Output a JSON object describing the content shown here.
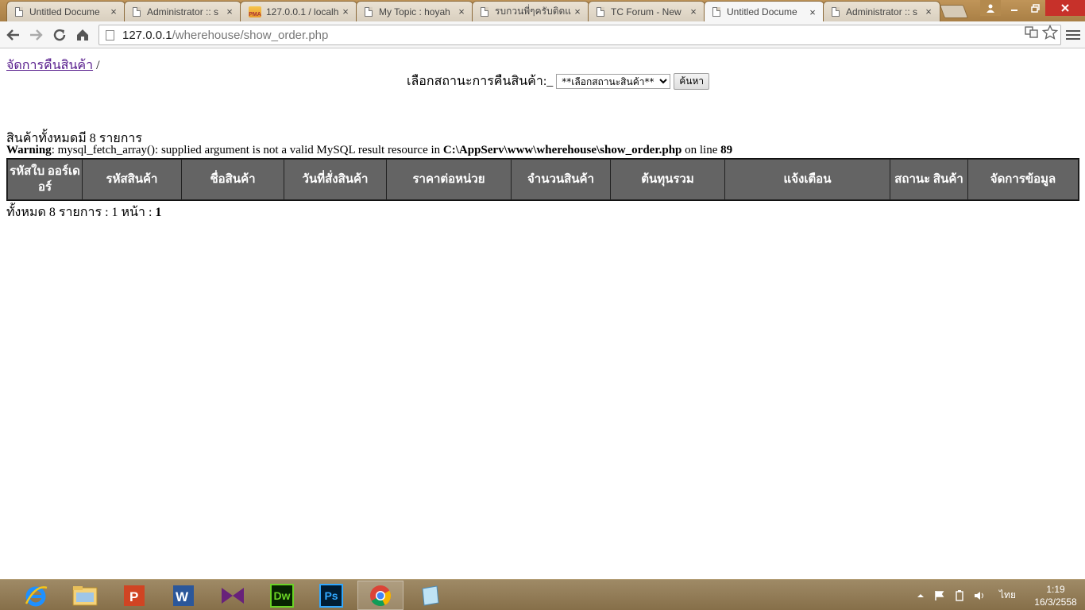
{
  "browser": {
    "tabs": [
      {
        "title": "Untitled Docume",
        "icon": "doc-icon",
        "active": false
      },
      {
        "title": "Administrator :: s",
        "icon": "doc-icon",
        "active": false
      },
      {
        "title": "127.0.0.1 / localh",
        "icon": "phpmyadmin-icon",
        "active": false
      },
      {
        "title": "My Topic : hoyah",
        "icon": "doc-icon",
        "active": false
      },
      {
        "title": "รบกวนพี่ๆครับติดแ",
        "icon": "doc-icon",
        "active": false
      },
      {
        "title": "TC Forum - New",
        "icon": "doc-icon",
        "active": false
      },
      {
        "title": "Untitled Docume",
        "icon": "doc-icon",
        "active": true
      },
      {
        "title": "Administrator :: s",
        "icon": "doc-icon",
        "active": false
      }
    ],
    "tab_close_glyph": "×",
    "pma_badge": "PMA",
    "url": {
      "host": "127.0.0.1",
      "path": "/wherehouse/show_order.php"
    }
  },
  "page": {
    "breadcrumb": {
      "link": "จัดการคืนสินค้า",
      "separator": " /"
    },
    "filter": {
      "label": "เลือกสถานะการคืนสินค้า:_",
      "select_value": "**เลือกสถานะสินค้า**",
      "search_button": "ค้นหา"
    },
    "total_text": "สินค้าทั้งหมดมี 8 รายการ",
    "warning": {
      "label": "Warning",
      "message": ": mysql_fetch_array(): supplied argument is not a valid MySQL result resource in ",
      "file": "C:\\AppServ\\www\\wherehouse\\show_order.php",
      "on_line": " on line ",
      "line": "89"
    },
    "table": {
      "headers": [
        "รหัสใบ ออร์เดอร์",
        "รหัสสินค้า",
        "ชื่อสินค้า",
        "วันที่สั่งสินค้า",
        "ราคาต่อหน่วย",
        "จำนวนสินค้า",
        "ต้นทุนรวม",
        "แจ้งเตือน",
        "สถานะ สินค้า",
        "จัดการข้อมูล"
      ]
    },
    "pager": {
      "text": "ทั้งหมด 8 รายการ : 1 หน้า : ",
      "current": "1"
    }
  },
  "taskbar": {
    "apps": [
      "internet-explorer-icon",
      "file-explorer-icon",
      "powerpoint-icon",
      "word-icon",
      "visual-studio-icon",
      "dreamweaver-icon",
      "photoshop-icon",
      "chrome-icon",
      "notepad-icon"
    ],
    "dreamweaver_label": "Dw",
    "photoshop_label": "Ps",
    "language": "ไทย",
    "time": "1:19",
    "date": "16/3/2558"
  },
  "colors": {
    "table_header_bg": "#646464",
    "link": "#551a8b",
    "tabstrip": "#b48a4e",
    "taskbar": "#9f8a66",
    "close_button": "#c7312a"
  }
}
